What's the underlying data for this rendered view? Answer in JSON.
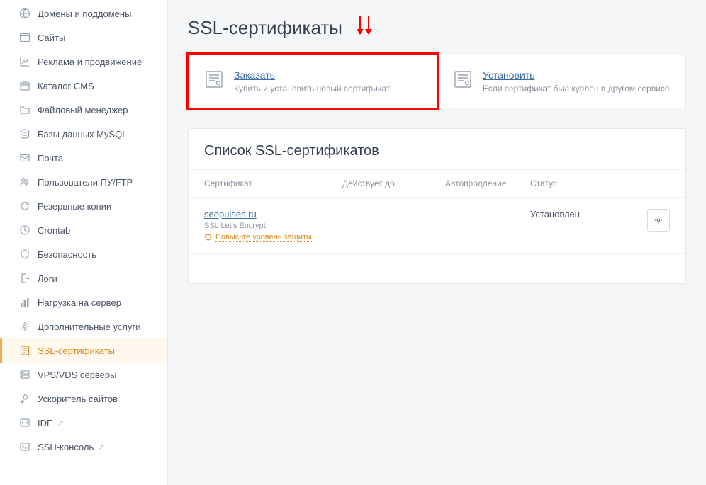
{
  "sidebar": {
    "items": [
      {
        "label": "Домены и поддомены"
      },
      {
        "label": "Сайты"
      },
      {
        "label": "Реклама и продвижение"
      },
      {
        "label": "Каталог CMS"
      },
      {
        "label": "Файловый менеджер"
      },
      {
        "label": "Базы данных MySQL"
      },
      {
        "label": "Почта"
      },
      {
        "label": "Пользователи ПУ/FTP"
      },
      {
        "label": "Резервные копии"
      },
      {
        "label": "Crontab"
      },
      {
        "label": "Безопасность"
      },
      {
        "label": "Логи"
      },
      {
        "label": "Нагрузка на сервер"
      },
      {
        "label": "Дополнительные услуги"
      },
      {
        "label": "SSL-сертификаты"
      },
      {
        "label": "VPS/VDS серверы"
      },
      {
        "label": "Ускоритель сайтов"
      },
      {
        "label": "IDE"
      },
      {
        "label": "SSH-консоль"
      }
    ]
  },
  "page": {
    "title": "SSL-сертификаты"
  },
  "cards": {
    "order": {
      "title": "Заказать",
      "sub": "Купить и установить новый сертификат"
    },
    "install": {
      "title": "Установить",
      "sub": "Если сертификат был куплен в другом сервисе"
    }
  },
  "list": {
    "title": "Список SSL-сертификатов",
    "headers": {
      "cert": "Сертификат",
      "expires": "Действует до",
      "autorenew": "Автопродление",
      "status": "Статус"
    },
    "rows": [
      {
        "name": "seopulses.ru",
        "type": "SSL Let's Encrypt",
        "warn": "Повысьте уровень защиты",
        "expires": "-",
        "autorenew": "-",
        "status": "Установлен"
      }
    ]
  }
}
